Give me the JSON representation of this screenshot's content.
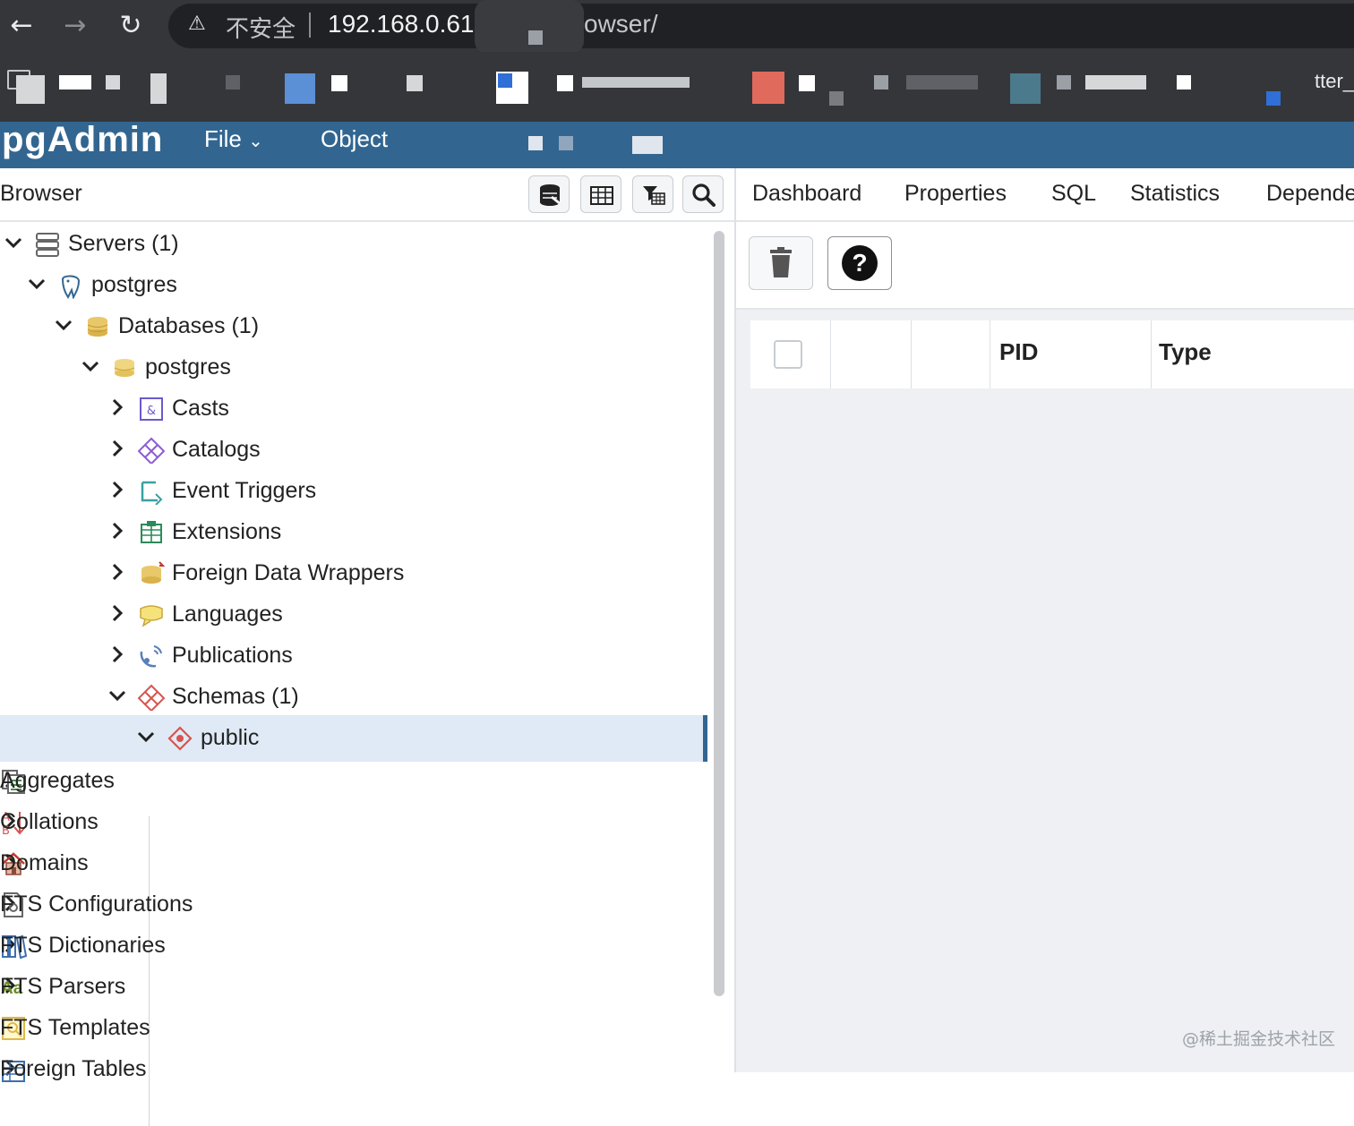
{
  "chrome": {
    "insecure_label": "不安全",
    "url_host": "192.168.0.61",
    "url_path": "owser/",
    "bookmark_fragment": "tter_"
  },
  "app": {
    "brand": "pgAdmin",
    "menu_file": "File",
    "menu_object": "Object"
  },
  "browser": {
    "title": "Browser",
    "tree": [
      {
        "label": "Servers (1)",
        "icon": "servers-icon",
        "expanded": true
      },
      {
        "label": "postgres",
        "icon": "elephant-icon",
        "expanded": true
      },
      {
        "label": "Databases (1)",
        "icon": "databases-icon",
        "expanded": true
      },
      {
        "label": "postgres",
        "icon": "database-icon",
        "expanded": true
      },
      {
        "label": "Casts",
        "icon": "casts-icon",
        "expanded": false
      },
      {
        "label": "Catalogs",
        "icon": "catalogs-icon",
        "expanded": false
      },
      {
        "label": "Event Triggers",
        "icon": "event-triggers-icon",
        "expanded": false
      },
      {
        "label": "Extensions",
        "icon": "extensions-icon",
        "expanded": false
      },
      {
        "label": "Foreign Data Wrappers",
        "icon": "foreign-data-wrappers-icon",
        "expanded": false
      },
      {
        "label": "Languages",
        "icon": "languages-icon",
        "expanded": false
      },
      {
        "label": "Publications",
        "icon": "publications-icon",
        "expanded": false
      },
      {
        "label": "Schemas (1)",
        "icon": "schemas-icon",
        "expanded": true
      },
      {
        "label": "public",
        "icon": "schema-icon",
        "expanded": true,
        "selected": true
      },
      {
        "label": "Aggregates",
        "icon": "aggregates-icon",
        "expanded": false
      },
      {
        "label": "Collations",
        "icon": "collations-icon",
        "expanded": false
      },
      {
        "label": "Domains",
        "icon": "domains-icon",
        "expanded": false
      },
      {
        "label": "FTS Configurations",
        "icon": "fts-configurations-icon",
        "expanded": false
      },
      {
        "label": "FTS Dictionaries",
        "icon": "fts-dictionaries-icon",
        "expanded": false
      },
      {
        "label": "FTS Parsers",
        "icon": "fts-parsers-icon",
        "expanded": false
      },
      {
        "label": "FTS Templates",
        "icon": "fts-templates-icon",
        "expanded": false
      },
      {
        "label": "Foreign Tables",
        "icon": "foreign-tables-icon",
        "expanded": false
      }
    ]
  },
  "tabs": [
    "Dashboard",
    "Properties",
    "SQL",
    "Statistics",
    "Dependencies"
  ],
  "grid": {
    "columns": [
      "PID",
      "Type"
    ]
  },
  "icons": {
    "fts_parsers_glyph": "Aa"
  },
  "watermark": "@稀土掘金技术社区",
  "colors": {
    "header_bg": "#326690",
    "selected_row": "#dfeaf6",
    "chrome_bg": "#35363a"
  }
}
